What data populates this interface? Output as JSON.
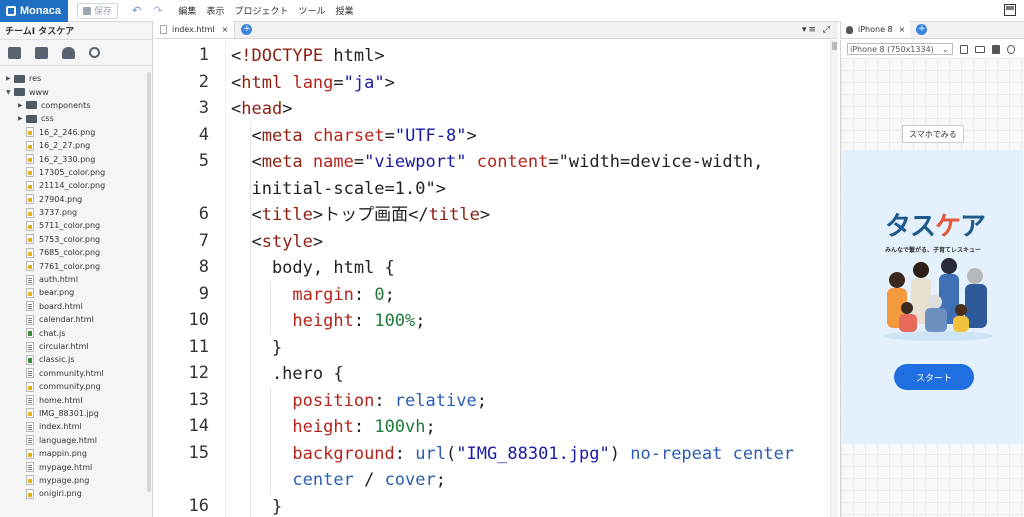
{
  "topbar": {
    "logo": "Monaca",
    "save_label": "保存",
    "menu": [
      "編集",
      "表示",
      "プロジェクト",
      "ツール",
      "授業"
    ]
  },
  "sidebar": {
    "title": "チームI タスケア",
    "folders": [
      {
        "name": "res",
        "expanded": false,
        "indent": 0
      },
      {
        "name": "www",
        "expanded": true,
        "indent": 0
      },
      {
        "name": "components",
        "expanded": false,
        "indent": 1
      },
      {
        "name": "css",
        "expanded": false,
        "indent": 1
      }
    ],
    "files": [
      {
        "name": "16_2_246.png",
        "type": "png"
      },
      {
        "name": "16_2_27.png",
        "type": "png"
      },
      {
        "name": "16_2_330.png",
        "type": "png"
      },
      {
        "name": "17305_color.png",
        "type": "png"
      },
      {
        "name": "21114_color.png",
        "type": "png"
      },
      {
        "name": "27904.png",
        "type": "png"
      },
      {
        "name": "3737.png",
        "type": "png"
      },
      {
        "name": "5711_color.png",
        "type": "png"
      },
      {
        "name": "5753_color.png",
        "type": "png"
      },
      {
        "name": "7685_color.png",
        "type": "png"
      },
      {
        "name": "7761_color.png",
        "type": "png"
      },
      {
        "name": "auth.html",
        "type": "html"
      },
      {
        "name": "bear.png",
        "type": "png"
      },
      {
        "name": "board.html",
        "type": "html"
      },
      {
        "name": "calendar.html",
        "type": "html"
      },
      {
        "name": "chat.js",
        "type": "js"
      },
      {
        "name": "circular.html",
        "type": "html"
      },
      {
        "name": "classic.js",
        "type": "js"
      },
      {
        "name": "community.html",
        "type": "html"
      },
      {
        "name": "community.png",
        "type": "png"
      },
      {
        "name": "home.html",
        "type": "html"
      },
      {
        "name": "IMG_88301.jpg",
        "type": "png"
      },
      {
        "name": "index.html",
        "type": "html"
      },
      {
        "name": "language.html",
        "type": "html"
      },
      {
        "name": "mappin.png",
        "type": "png"
      },
      {
        "name": "mypage.html",
        "type": "html"
      },
      {
        "name": "mypage.png",
        "type": "png"
      },
      {
        "name": "onigiri.png",
        "type": "png"
      }
    ]
  },
  "editor": {
    "tab_label": "index.html",
    "line_numbers": [
      "1",
      "2",
      "3",
      "4",
      "5",
      "6",
      "7",
      "8",
      "9",
      "10",
      "11",
      "12",
      "13",
      "14",
      "15",
      "16"
    ],
    "lines": [
      "<!DOCTYPE html>",
      "<html lang=\"ja\">",
      "<head>",
      "  <meta charset=\"UTF-8\">",
      "  <meta name=\"viewport\" content=\"width=device-width,",
      "  initial-scale=1.0\">",
      "  <title>トップ画面</title>",
      "  <style>",
      "    body, html {",
      "      margin: 0;",
      "      height: 100%;",
      "    }",
      "    .hero {",
      "      position: relative;",
      "      height: 100vh;",
      "      background: url(\"IMG_88301.jpg\") no-repeat center",
      "      center / cover;",
      "    }"
    ]
  },
  "preview": {
    "tab_label": "iPhone 8",
    "device_select": "iPhone 8 (750x1334)",
    "smartphone_button": "スマホでみる",
    "app_title_a": "タス",
    "app_title_b": "ケ",
    "app_title_c": "ア",
    "app_subtitle": "みんなで繋がる、子育てレスキュー",
    "start_button": "スタート"
  },
  "colors": {
    "brand": "#1f6fc4",
    "start_button": "#1f6fe0",
    "title_blue": "#1e5a8c",
    "title_red": "#e05a3c"
  }
}
